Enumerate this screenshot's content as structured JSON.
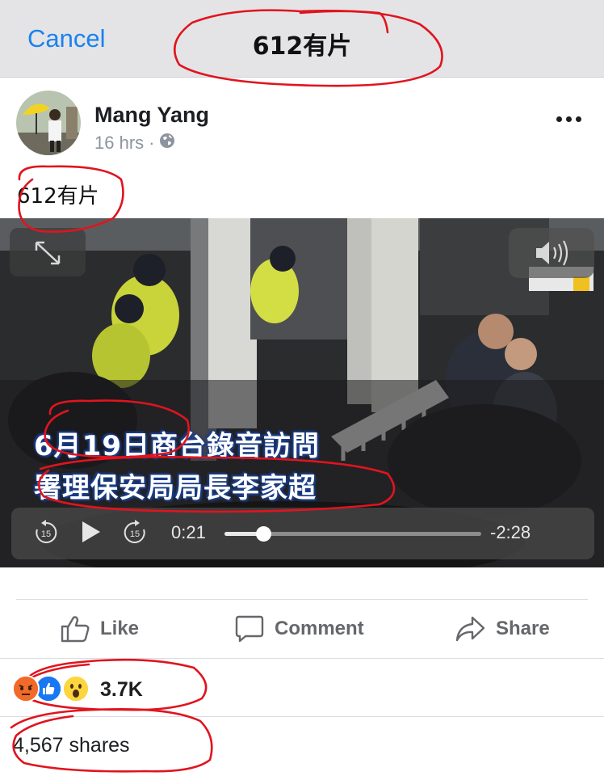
{
  "navbar": {
    "cancel_label": "Cancel",
    "title": "612有片"
  },
  "post": {
    "author": "Mang Yang",
    "time": "16 hrs",
    "separator": "·",
    "privacy_icon": "globe-icon",
    "text": "612有片"
  },
  "video": {
    "caption_line1": "6月19日商台錄音訪問",
    "caption_line2": "署理保安局局長李家超",
    "skip_back_label": "15",
    "skip_forward_label": "15",
    "elapsed": "0:21",
    "remaining": "-2:28",
    "progress": 0.15
  },
  "actions": {
    "like": "Like",
    "comment": "Comment",
    "share": "Share"
  },
  "reactions": {
    "icons": [
      "angry-reaction-icon",
      "like-reaction-icon",
      "wow-reaction-icon"
    ],
    "count": "3.7K"
  },
  "shares_text": "4,567 shares",
  "colors": {
    "link": "#1a82f0",
    "annotation": "#e0141e",
    "like_blue": "#1877f2"
  }
}
